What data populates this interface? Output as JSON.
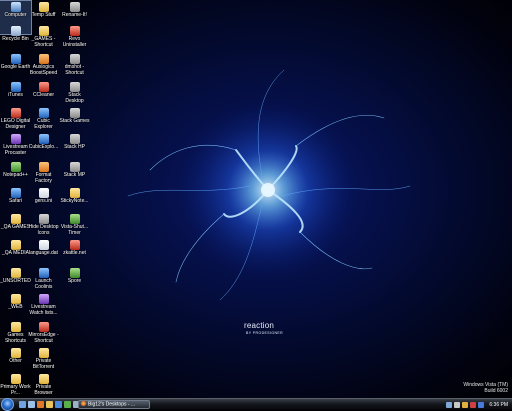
{
  "colors": {
    "wallpaper_core": "#0b1e78",
    "wallpaper_edge": "#000000",
    "taskbar": "#14171d",
    "icon_label": "#ffffff"
  },
  "desktop": {
    "icons": [
      {
        "label": "Computer",
        "icon": "computer-icon",
        "style": "g-computer",
        "selected": true
      },
      {
        "label": "Temp Stuff",
        "icon": "folder-icon",
        "style": "g-folder"
      },
      {
        "label": "Rename-It!",
        "icon": "rename-app-icon",
        "style": "g-app"
      },
      {
        "label": "Recycle Bin",
        "icon": "recycle-bin-icon",
        "style": "g-recycle"
      },
      {
        "label": "_GAMES - Shortcut",
        "icon": "folder-shortcut-icon",
        "style": "g-folder"
      },
      {
        "label": "Revo Uninstaller",
        "icon": "revo-uninstaller-icon",
        "style": "g-red"
      },
      {
        "label": "Google Earth",
        "icon": "globe-icon",
        "style": "g-blue"
      },
      {
        "label": "Auslogics BoostSpeed",
        "icon": "boostspeed-icon",
        "style": "g-orange"
      },
      {
        "label": "dmshot - Shortcut",
        "icon": "screenshot-app-icon",
        "style": "g-app"
      },
      {
        "label": "iTunes",
        "icon": "itunes-icon",
        "style": "g-blue"
      },
      {
        "label": "CCleaner",
        "icon": "ccleaner-icon",
        "style": "g-red"
      },
      {
        "label": "Stack Desktop",
        "icon": "stack-icon",
        "style": "g-app"
      },
      {
        "label": "LEGO Digital Designer",
        "icon": "lego-icon",
        "style": "g-red"
      },
      {
        "label": "Cubic Explorer",
        "icon": "cubic-explorer-icon",
        "style": "g-blue"
      },
      {
        "label": "Stack Games",
        "icon": "stack-icon",
        "style": "g-app"
      },
      {
        "label": "Livestream Procaster",
        "icon": "livestream-icon",
        "style": "g-purple"
      },
      {
        "label": "CubicExplo...",
        "icon": "cubic-explorer-icon",
        "style": "g-blue"
      },
      {
        "label": "Stack HP",
        "icon": "stack-icon",
        "style": "g-app"
      },
      {
        "label": "Notepad++",
        "icon": "notepad-icon",
        "style": "g-green"
      },
      {
        "label": "Format Factory",
        "icon": "format-factory-icon",
        "style": "g-orange"
      },
      {
        "label": "Stack MP",
        "icon": "stack-icon",
        "style": "g-app"
      },
      {
        "label": "Safari",
        "icon": "safari-compass-icon",
        "style": "g-blue"
      },
      {
        "label": "gens.ini",
        "icon": "text-file-icon",
        "style": "g-doc"
      },
      {
        "label": "StickyNote...",
        "icon": "sticky-note-icon",
        "style": "g-folder"
      },
      {
        "label": "_QA GAMES",
        "icon": "folder-icon",
        "style": "g-folder"
      },
      {
        "label": "Hide Desktop Icons",
        "icon": "hide-desktop-icon",
        "style": "g-app"
      },
      {
        "label": "Vista-Shut... Timer",
        "icon": "timer-icon",
        "style": "g-green"
      },
      {
        "label": "_QA MEDIA",
        "icon": "folder-icon",
        "style": "g-folder"
      },
      {
        "label": "language.dat",
        "icon": "data-file-icon",
        "style": "g-doc"
      },
      {
        "label": "zkattle.net",
        "icon": "web-shortcut-icon",
        "style": "g-red"
      },
      {
        "label": "_UNSORTED",
        "icon": "folder-icon",
        "style": "g-folder"
      },
      {
        "label": "Launch Coolinis",
        "icon": "launcher-icon",
        "style": "g-blue"
      },
      {
        "label": "Spore",
        "icon": "spore-icon",
        "style": "g-green"
      },
      {
        "label": "_WEB",
        "icon": "folder-icon",
        "style": "g-folder"
      },
      {
        "label": "Livestream Watch lists...",
        "icon": "livestream-icon",
        "style": "g-purple"
      },
      {
        "label": "Games Shortcuts",
        "icon": "folder-icon",
        "style": "g-folder"
      },
      {
        "label": "MirrorsEdge - Shortcut",
        "icon": "mirrors-edge-icon",
        "style": "g-red"
      },
      {
        "label": "Other",
        "icon": "folder-icon",
        "style": "g-folder"
      },
      {
        "label": "Private BitTorrent",
        "icon": "folder-icon",
        "style": "g-folder"
      },
      {
        "label": "Primary Work Pr...",
        "icon": "folder-icon",
        "style": "g-folder"
      },
      {
        "label": "Private Browser",
        "icon": "folder-icon",
        "style": "g-folder"
      }
    ]
  },
  "wallpaper": {
    "logo_word": "reaction",
    "logo_byline": "BY PRODESIGNER"
  },
  "watermark": {
    "line1": "Windows Vista (TM)",
    "line2": "Build 6002"
  },
  "taskbar": {
    "start_icon": "windows-orb-icon",
    "quick_launch": [
      {
        "icon": "show-desktop-icon",
        "color": "#6fa2e0"
      },
      {
        "icon": "switch-windows-icon",
        "color": "#9cc0e8"
      },
      {
        "icon": "firefox-icon",
        "color": "#e07a2a"
      },
      {
        "icon": "explorer-icon",
        "color": "#e8c25a"
      },
      {
        "icon": "media-player-icon",
        "color": "#4a8ad8"
      },
      {
        "icon": "chat-icon",
        "color": "#5ab04a"
      },
      {
        "icon": "mail-icon",
        "color": "#9cb0c8"
      }
    ],
    "active_window": "Big12's Desktops - ...",
    "tray": [
      {
        "icon": "network-icon",
        "color": "#7fa8d8"
      },
      {
        "icon": "volume-icon",
        "color": "#c8c8c8"
      },
      {
        "icon": "update-icon",
        "color": "#e0b040"
      },
      {
        "icon": "antivirus-icon",
        "color": "#d04040"
      },
      {
        "icon": "bluetooth-icon",
        "color": "#4a7ad8"
      }
    ],
    "clock": "6:36 PM"
  }
}
